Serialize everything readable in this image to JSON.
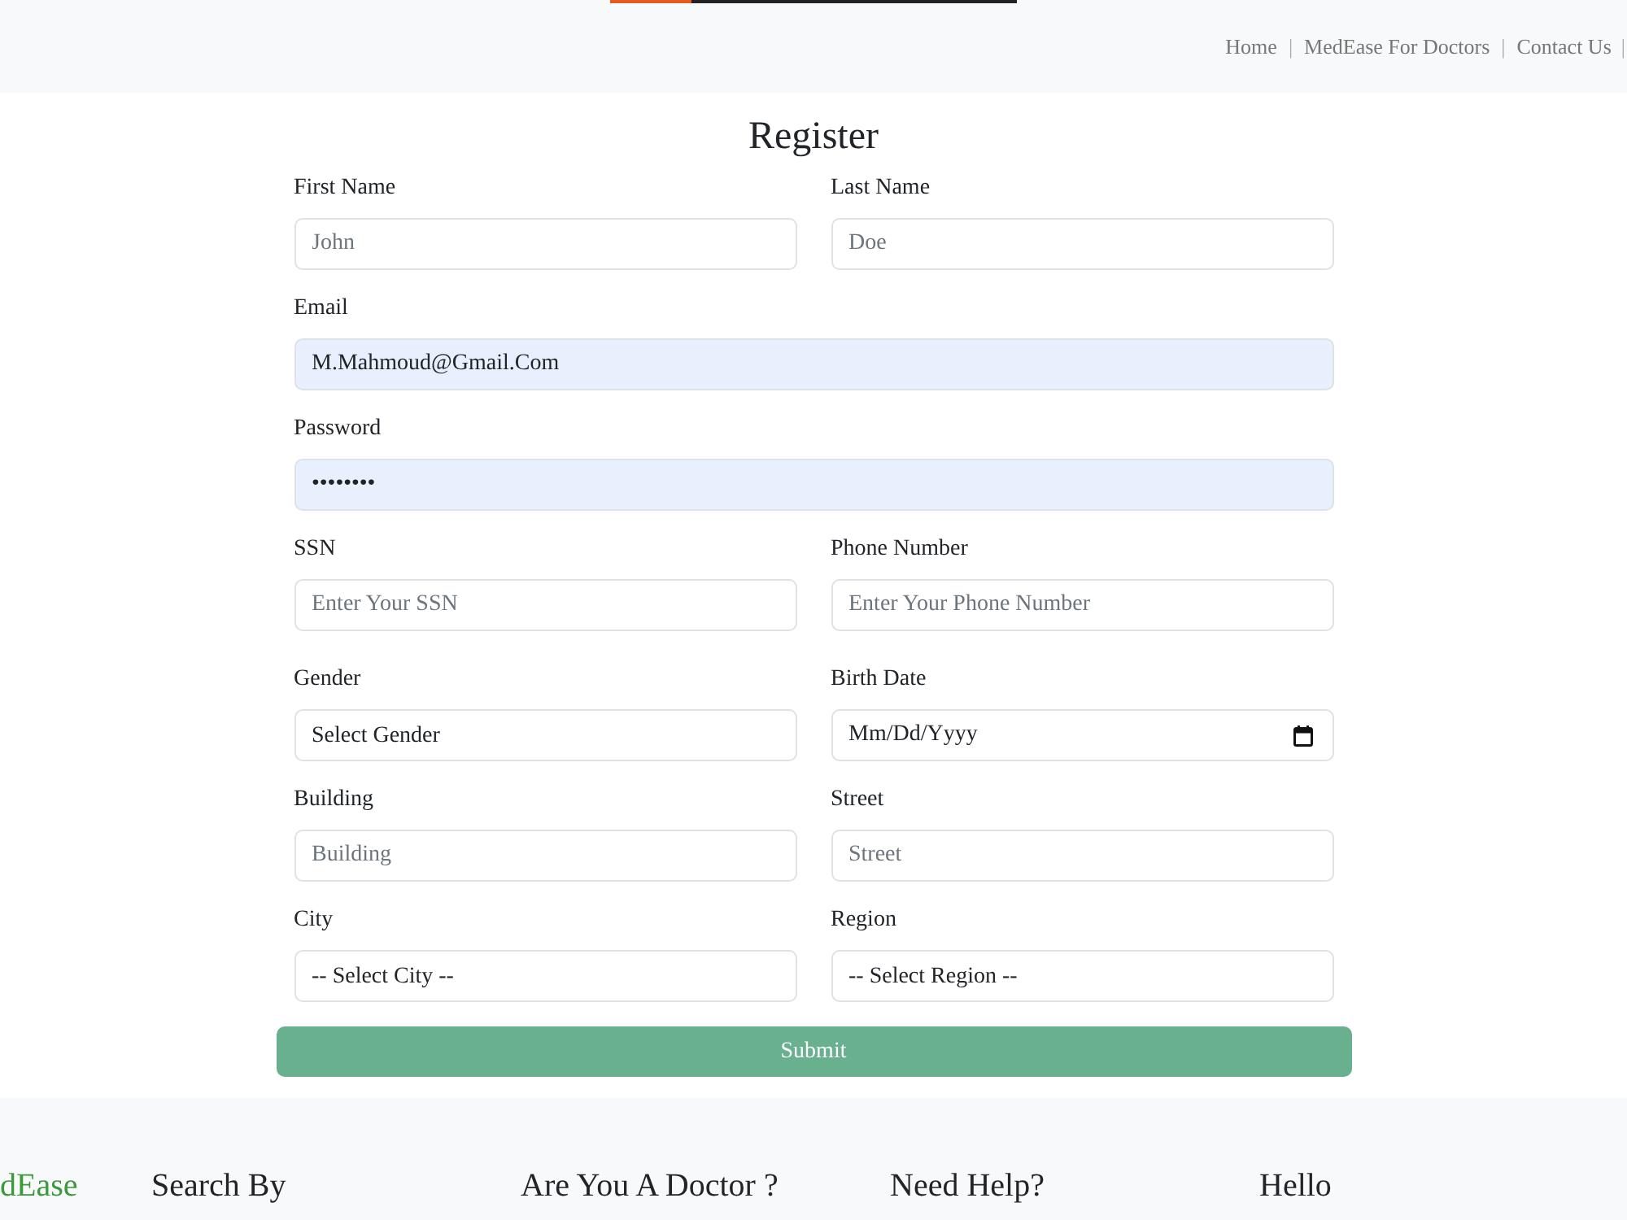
{
  "header": {
    "nav": [
      {
        "label": "Home",
        "separator": "|"
      },
      {
        "label": "MedEase For Doctors",
        "separator": "|"
      },
      {
        "label": "Contact Us",
        "separator": "|"
      }
    ]
  },
  "form": {
    "title": "Register",
    "rows": [
      [
        {
          "label": "First Name",
          "kind": "text",
          "placeholder": "John",
          "autofilled": false
        },
        {
          "label": "Last Name",
          "kind": "text",
          "placeholder": "Doe",
          "autofilled": false
        }
      ],
      [
        {
          "label": "Email",
          "kind": "text",
          "value": "M.Mahmoud@Gmail.Com",
          "autofilled": true
        }
      ],
      [
        {
          "label": "Password",
          "kind": "text",
          "value": "••••••••",
          "autofilled": true
        }
      ],
      [
        {
          "label": "SSN",
          "kind": "text",
          "placeholder": "Enter Your SSN",
          "autofilled": false
        },
        {
          "label": "Phone Number",
          "kind": "text",
          "placeholder": "Enter Your Phone Number",
          "autofilled": false
        }
      ],
      [
        {
          "label": "Gender",
          "kind": "select",
          "value": "Select Gender",
          "autofilled": false
        },
        {
          "label": "Birth Date",
          "kind": "date",
          "value": "Mm/Dd/Yyyy",
          "autofilled": false
        }
      ],
      [
        {
          "label": "Building",
          "kind": "text",
          "placeholder": "Building",
          "autofilled": false
        },
        {
          "label": "Street",
          "kind": "text",
          "placeholder": "Street",
          "autofilled": false
        }
      ],
      [
        {
          "label": "City",
          "kind": "select",
          "value": "-- Select City --",
          "autofilled": false
        },
        {
          "label": "Region",
          "kind": "select",
          "value": "-- Select Region --",
          "autofilled": false
        }
      ]
    ],
    "submit": "Submit"
  },
  "footer": {
    "logo": "dEase",
    "columns": [
      {
        "heading": "Search By"
      },
      {
        "heading": "Are You A Doctor ?"
      },
      {
        "heading": "Need Help?"
      },
      {
        "heading": "Hello"
      }
    ]
  }
}
